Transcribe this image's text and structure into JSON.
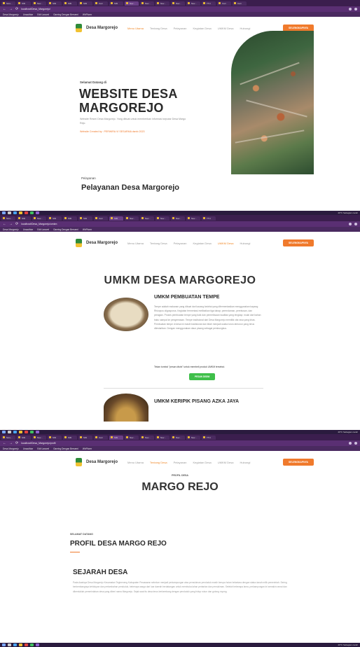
{
  "browser": {
    "tabs": [
      "Scre...",
      "SIM",
      "Nav...",
      "SIM",
      "SIM",
      "SIM",
      "Cari",
      "SIM",
      "Nav...",
      "Nav...",
      "Nav...",
      "Nav...",
      "Nav...",
      "TTU",
      "Cari",
      "Cari"
    ],
    "url_home": "localhost/Desa_Margorejo/",
    "url_umkm": "localhost/Desa_Margorejo/umkm",
    "url_profil": "localhost/Desa_Margorejo/profil",
    "bookmarks": [
      "Desa Margorejo",
      "Unsadhiar",
      "Edit Laravel",
      "Gaming Dengan Bersemi",
      "WhPlorer"
    ],
    "tray": "29°C Sebagian cerah"
  },
  "site": {
    "brand": "Desa Margorejo",
    "menu": [
      "Menu Utama",
      "Tentang Desa",
      "Pelayanan",
      "Kegiatan Desa",
      "UMKM Desa",
      "Hubungi"
    ],
    "cta": "SELENGKAPNYA"
  },
  "home": {
    "welcome": "Selamat Datang di",
    "title_line1": "WEBSITE DESA",
    "title_line2": "MARGOREJO",
    "desc": "Website Resmi Desa Margorejo. Yang dibuat untuk memberikan informasi seputar Desa Margo Rejo.",
    "made": "Website Created by : PERWIRA VI SESARMA dsmb 2023",
    "services_kicker": "Pelayanan",
    "services_title": "Pelayanan Desa Margorejo"
  },
  "umkm": {
    "title": "UMKM DESA MARGOREJO",
    "item1_title": "UMKM PEMBUATAN TEMPE",
    "item1_body": "Tempe adalah makanan yang dibuat dari kacang kedelai yang difermentasikan menggunakan kapang Rhizopus oligosporus. Kegiatan fermentasi melibatkan tiga tahap; perendaman, perebusan, dan peragian. Proses pembuatan tempe yang baik dan pemeriksaan kualitas yang lengkap; mulai dari bahan baku sampai ke pengemasan. Tempe tradisional dari Desa Margorejo memiliki cita rasa yang khas. Pembuatan tempe di desa ini masih tradisional dan telah menjadi usaha turun-temurun yang terus dilestarikan. Dengan menggunakan daun pisang sebagai pembungkus.",
    "item1_note": "Tekan tombol \"pesan disini\" untuk membeli produk UMKM tersebut.",
    "order_button": "PESAN DISINI",
    "item2_title": "UMKM KERIPIK PISANG AZKA JAYA"
  },
  "profil": {
    "kicker": "PROFIL DESA",
    "title": "MARGO REJO",
    "selamat": "SELAMAT DATANG",
    "heading": "PROFIL DESA MARGO REJO",
    "sejarah_h": "SEJARAH DESA",
    "sejarah_body": "Pada Awalnya Desa Margorejo Kecamatan Tegineneng Kabupaten Pesawaran sebelum menjadi perkampungan atau pemukiman penduduk masih berupa hutan belantara dengan status tanah milik pemerintah. Sering berkembangnya kehidupan dan pertambahan penduduk, beberapa warga dari luar daerah berdatangan untuk membuka lahan pertanian dan pemukiman. Setelah beberapa lama, perkampungan ini semakin ramai dan dibentuklah pemerintahan desa yang diberi nama Margorejo. Sejak saat itu desa terus berkembang dengan penduduk yang hidup rukun dan gotong royong."
  }
}
